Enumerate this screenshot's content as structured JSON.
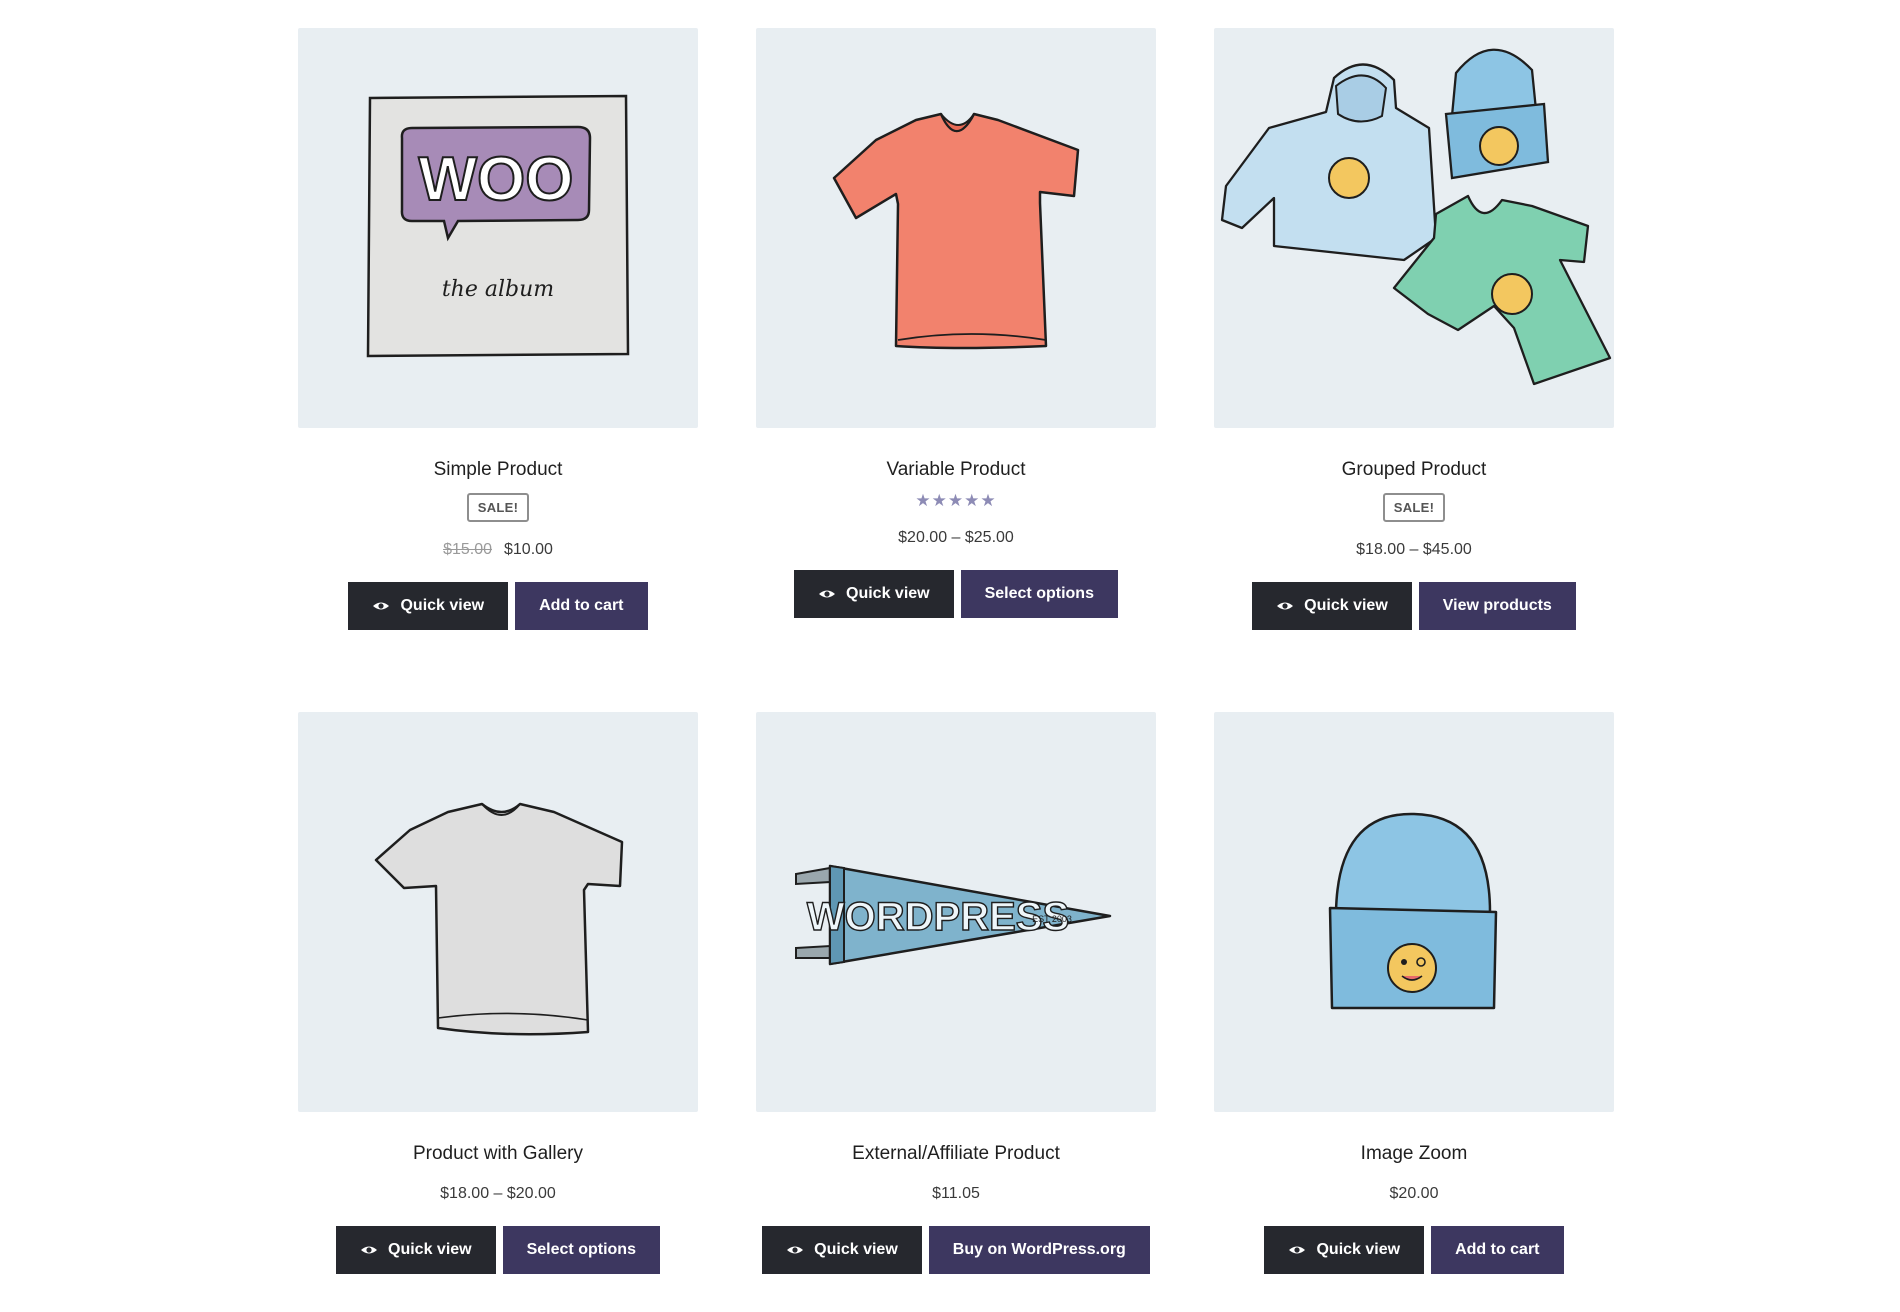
{
  "quick_view_label": "Quick view",
  "colors": {
    "thumb_bg": "#e8eef2",
    "btn_dark": "#26282e",
    "btn_purple": "#3d3760",
    "stars": "#8d8bb5"
  },
  "products": [
    {
      "title": "Simple Product",
      "badge": "SALE!",
      "price_old": "$15.00",
      "price": "$10.00",
      "action": "Add to cart",
      "image": "woo-album-icon"
    },
    {
      "title": "Variable Product",
      "stars": "★★★★★",
      "rating": 5,
      "price": "$20.00 – $25.00",
      "action": "Select options",
      "image": "vneck-tshirt-icon"
    },
    {
      "title": "Grouped Product",
      "badge": "SALE!",
      "price": "$18.00 – $45.00",
      "action": "View products",
      "image": "hoodie-beanie-tshirt-icon"
    },
    {
      "title": "Product with Gallery",
      "price": "$18.00 – $20.00",
      "action": "Select options",
      "image": "grey-tshirt-icon"
    },
    {
      "title": "External/Affiliate Product",
      "price": "$11.05",
      "action": "Buy on WordPress.org",
      "image": "wordpress-pennant-icon"
    },
    {
      "title": "Image Zoom",
      "price": "$20.00",
      "action": "Add to cart",
      "image": "beanie-icon"
    }
  ],
  "images": {
    "woo_text": "WOO",
    "album_text": "the album",
    "pennant_text": "WORDPRESS",
    "pennant_small": "EST 2003"
  }
}
